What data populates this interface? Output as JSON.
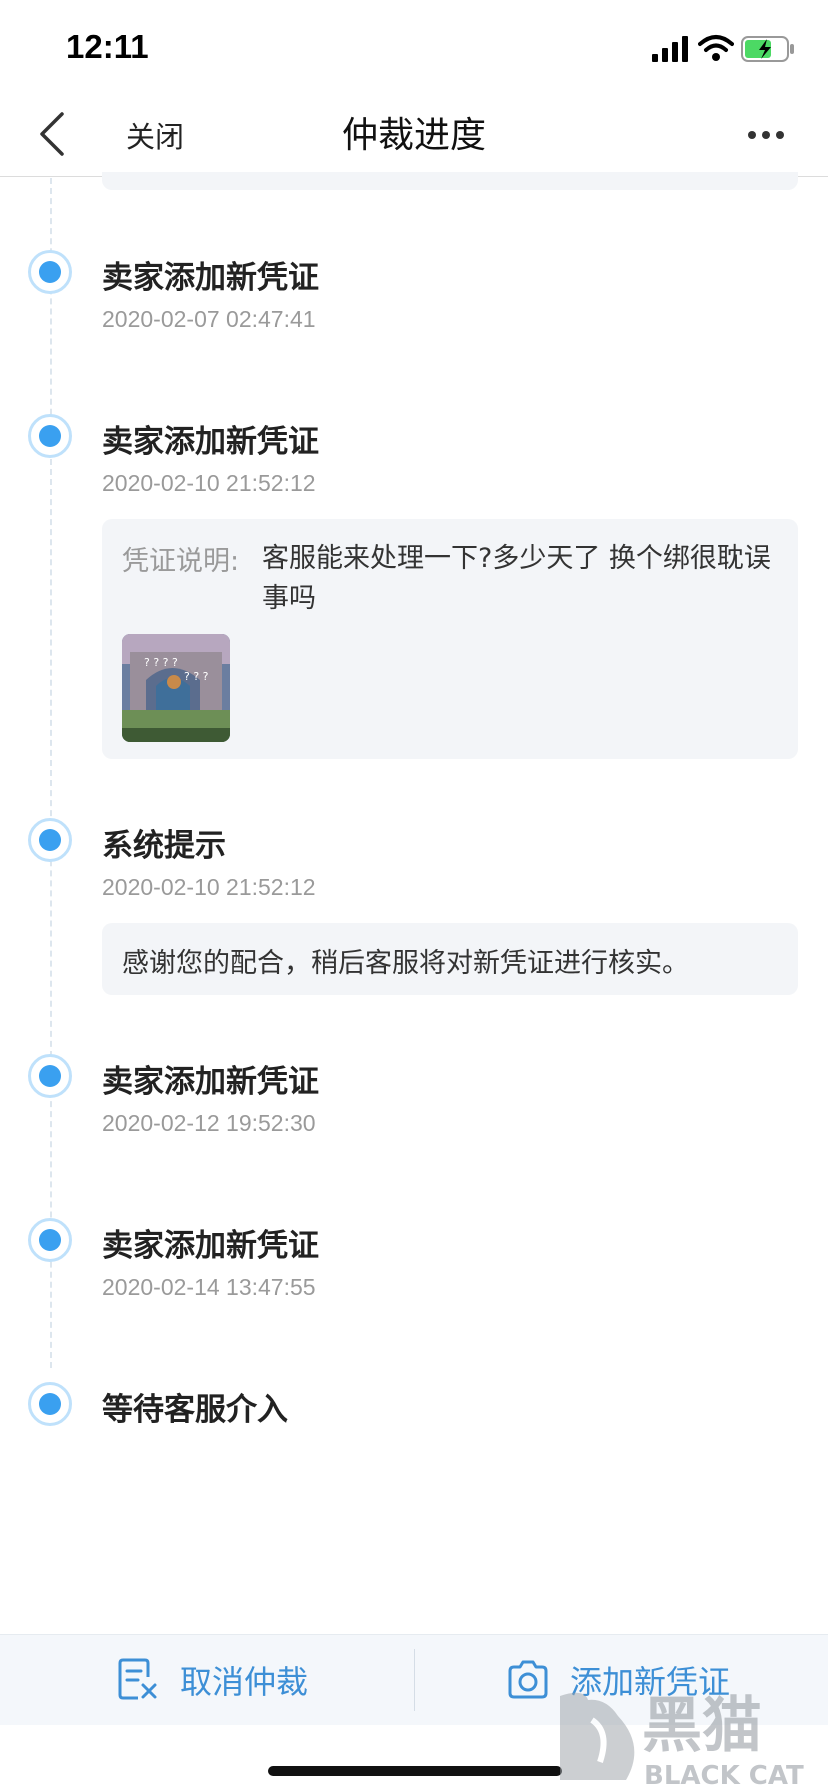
{
  "status_bar": {
    "time": "12:11"
  },
  "nav": {
    "close_label": "关闭",
    "title": "仲裁进度"
  },
  "timeline": [
    {
      "title": "卖家添加新凭证",
      "time": "2020-02-07 02:47:41"
    },
    {
      "title": "卖家添加新凭证",
      "time": "2020-02-10 21:52:12",
      "evidence_label": "凭证说明:",
      "evidence_text": "客服能来处理一下?多少天了 换个绑很耽误事吗"
    },
    {
      "title": "系统提示",
      "time": "2020-02-10 21:52:12",
      "notice": "感谢您的配合，稍后客服将对新凭证进行核实。"
    },
    {
      "title": "卖家添加新凭证",
      "time": "2020-02-12 19:52:30"
    },
    {
      "title": "卖家添加新凭证",
      "time": "2020-02-14 13:47:55"
    },
    {
      "title": "等待客服介入"
    }
  ],
  "bottom_bar": {
    "cancel_label": "取消仲裁",
    "add_label": "添加新凭证"
  },
  "watermark": {
    "text_cn": "黑猫",
    "text_en": "BLACK CAT"
  },
  "colors": {
    "accent": "#3d8fd6",
    "dot": "#3aa0f0",
    "card_bg": "#f3f5f8"
  }
}
